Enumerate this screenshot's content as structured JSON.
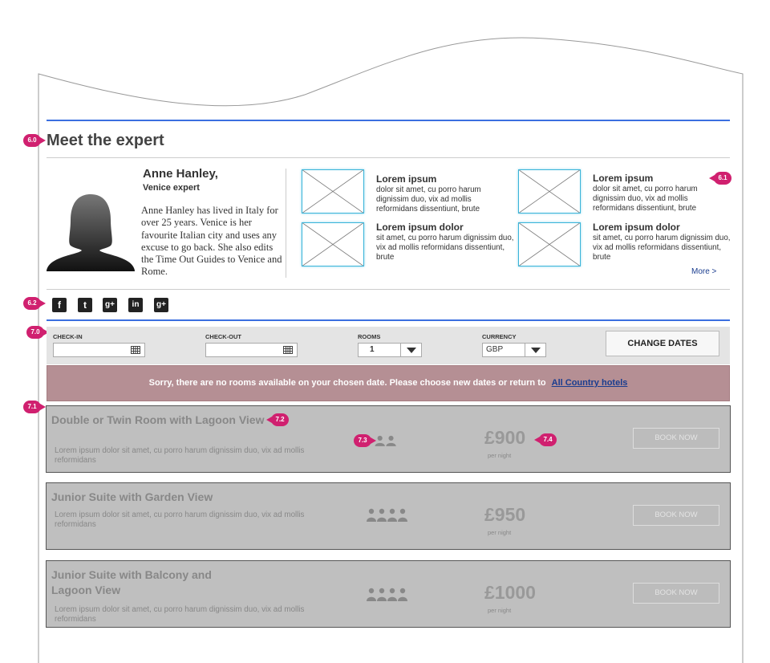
{
  "expert": {
    "section_title": "Meet the expert",
    "name": "Anne Hanley,",
    "role": "Venice expert",
    "bio": "Anne Hanley has lived in Italy for over 25 years. Venice is her favourite Italian city and uses any excuse to go back. She also edits the Time Out Guides to Venice and Rome."
  },
  "articles": [
    {
      "title": "Lorem ipsum",
      "text": "dolor sit amet, cu porro harum dignissim duo, vix ad mollis reformidans dissentiunt, brute"
    },
    {
      "title": "Lorem ipsum dolor",
      "text": "sit amet, cu porro harum dignissim duo, vix ad mollis reformidans dissentiunt, brute"
    },
    {
      "title": "Lorem ipsum",
      "text": "dolor sit amet, cu porro harum dignissim duo, vix ad mollis reformidans dissentiunt, brute"
    },
    {
      "title": "Lorem ipsum dolor",
      "text": "sit amet, cu porro harum dignissim duo, vix ad mollis reformidans dissentiunt, brute"
    }
  ],
  "more_link": "More >",
  "social": {
    "facebook": "f",
    "twitter": "t",
    "googleplus": "g+",
    "linkedin": "in",
    "googleplus2": "g+"
  },
  "booking": {
    "checkin_label": "CHECK-IN",
    "checkout_label": "CHECK-OUT",
    "rooms_label": "ROOMS",
    "rooms_value": "1",
    "currency_label": "CURRENCY",
    "currency_value": "GBP",
    "change_dates": "CHANGE DATES"
  },
  "alert": {
    "message": "Sorry, there are no rooms available on your chosen date. Please choose new dates or return to",
    "link": "All Country hotels"
  },
  "rooms": [
    {
      "title": "Double or Twin Room with Lagoon View",
      "desc": "Lorem ipsum dolor sit amet, cu porro harum dignissim duo, vix ad mollis reformidans",
      "price": "£900",
      "per": "per night",
      "book": "BOOK NOW"
    },
    {
      "title": "Junior Suite with Garden View",
      "desc": "Lorem ipsum dolor sit amet, cu porro harum dignissim duo, vix ad mollis reformidans",
      "price": "£950",
      "per": "per night",
      "book": "BOOK NOW"
    },
    {
      "title": "Junior Suite with Balcony and Lagoon View",
      "desc": "Lorem ipsum dolor sit amet, cu porro harum dignissim duo, vix ad mollis reformidans",
      "price": "£1000",
      "per": "per night",
      "book": "BOOK NOW"
    }
  ],
  "annotations": {
    "a60": "6.0",
    "a61": "6.1",
    "a62": "6.2",
    "a70": "7.0",
    "a71": "7.1",
    "a72": "7.2",
    "a73": "7.3",
    "a74": "7.4"
  },
  "colors": {
    "accent_rule": "#3b6fe0",
    "annotation": "#d0206f",
    "alert_bg": "#b58f94",
    "thumb_border": "#3ab4d9",
    "room_bg": "#bfbfbf"
  }
}
